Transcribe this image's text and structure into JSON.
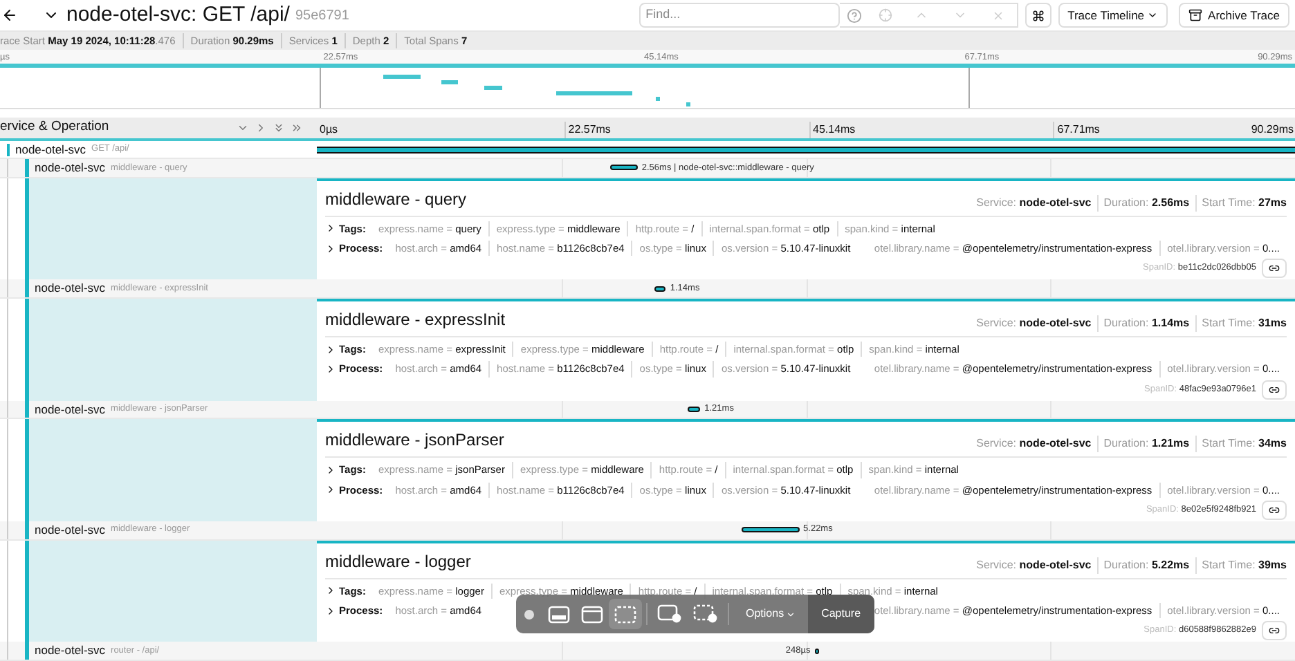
{
  "header": {
    "title": "node-otel-svc: GET /api/",
    "trace_id": "95e6791",
    "search": {
      "placeholder": "Find..."
    },
    "view_select": "Trace Timeline",
    "archive": "Archive Trace"
  },
  "summary": [
    {
      "label": "race Start",
      "value": "May 19 2024, 10:11:28",
      "suffix": ".476"
    },
    {
      "label": "Duration",
      "value": "90.29ms"
    },
    {
      "label": "Services",
      "value": "1"
    },
    {
      "label": "Depth",
      "value": "2"
    },
    {
      "label": "Total Spans",
      "value": "7"
    }
  ],
  "minimap": {
    "ticks": [
      "µs",
      "22.57ms",
      "45.14ms",
      "67.71ms",
      "90.29ms"
    ]
  },
  "columns": {
    "title": "ervice & Operation",
    "ticks": [
      "0µs",
      "22.57ms",
      "45.14ms",
      "67.71ms",
      "90.29ms"
    ]
  },
  "root": {
    "service": "node-otel-svc",
    "operation": "GET /api/",
    "children": [
      {
        "service": "node-otel-svc",
        "operation": "middleware - query",
        "bar_label": "2.56ms | node-otel-svc::middleware - query",
        "expanded": true,
        "detail": {
          "title": "middleware - query",
          "service_label": "Service:",
          "service": "node-otel-svc",
          "duration_label": "Duration:",
          "duration": "2.56ms",
          "start_label": "Start Time:",
          "start_time": "27ms",
          "tags_label": "Tags:",
          "tags": [
            {
              "key": "express.name =",
              "value": "query"
            },
            {
              "key": "express.type =",
              "value": "middleware"
            },
            {
              "key": "http.route =",
              "value": "/"
            },
            {
              "key": "internal.span.format =",
              "value": "otlp"
            },
            {
              "key": "span.kind =",
              "value": "internal"
            }
          ],
          "process_label": "Process:",
          "process": [
            {
              "key": "host.arch =",
              "value": "amd64"
            },
            {
              "key": "host.name =",
              "value": "b1126c8cb7e4"
            },
            {
              "key": "os.type =",
              "value": "linux"
            },
            {
              "key": "os.version =",
              "value": "5.10.47-linuxkit"
            },
            {
              "key": "otel.library.name =",
              "value": "@opentelemetry/instrumentation-express"
            },
            {
              "key": "otel.library.version =",
              "value": "0...."
            }
          ],
          "span_id_label": "SpanID:",
          "span_id": "be11c2dc026dbb05"
        }
      },
      {
        "service": "node-otel-svc",
        "operation": "middleware - expressInit",
        "bar_label": "1.14ms",
        "expanded": true,
        "detail": {
          "title": "middleware - expressInit",
          "service_label": "Service:",
          "service": "node-otel-svc",
          "duration_label": "Duration:",
          "duration": "1.14ms",
          "start_label": "Start Time:",
          "start_time": "31ms",
          "tags_label": "Tags:",
          "tags": [
            {
              "key": "express.name =",
              "value": "expressInit"
            },
            {
              "key": "express.type =",
              "value": "middleware"
            },
            {
              "key": "http.route =",
              "value": "/"
            },
            {
              "key": "internal.span.format =",
              "value": "otlp"
            },
            {
              "key": "span.kind =",
              "value": "internal"
            }
          ],
          "process_label": "Process:",
          "process": [
            {
              "key": "host.arch =",
              "value": "amd64"
            },
            {
              "key": "host.name =",
              "value": "b1126c8cb7e4"
            },
            {
              "key": "os.type =",
              "value": "linux"
            },
            {
              "key": "os.version =",
              "value": "5.10.47-linuxkit"
            },
            {
              "key": "otel.library.name =",
              "value": "@opentelemetry/instrumentation-express"
            },
            {
              "key": "otel.library.version =",
              "value": "0...."
            }
          ],
          "span_id_label": "SpanID:",
          "span_id": "48fac9e93a0796e1"
        }
      },
      {
        "service": "node-otel-svc",
        "operation": "middleware - jsonParser",
        "bar_label": "1.21ms",
        "expanded": true,
        "detail": {
          "title": "middleware - jsonParser",
          "service_label": "Service:",
          "service": "node-otel-svc",
          "duration_label": "Duration:",
          "duration": "1.21ms",
          "start_label": "Start Time:",
          "start_time": "34ms",
          "tags_label": "Tags:",
          "tags": [
            {
              "key": "express.name =",
              "value": "jsonParser"
            },
            {
              "key": "express.type =",
              "value": "middleware"
            },
            {
              "key": "http.route =",
              "value": "/"
            },
            {
              "key": "internal.span.format =",
              "value": "otlp"
            },
            {
              "key": "span.kind =",
              "value": "internal"
            }
          ],
          "process_label": "Process:",
          "process": [
            {
              "key": "host.arch =",
              "value": "amd64"
            },
            {
              "key": "host.name =",
              "value": "b1126c8cb7e4"
            },
            {
              "key": "os.type =",
              "value": "linux"
            },
            {
              "key": "os.version =",
              "value": "5.10.47-linuxkit"
            },
            {
              "key": "otel.library.name =",
              "value": "@opentelemetry/instrumentation-express"
            },
            {
              "key": "otel.library.version =",
              "value": "0...."
            }
          ],
          "span_id_label": "SpanID:",
          "span_id": "8e02e5f9248fb921"
        }
      },
      {
        "service": "node-otel-svc",
        "operation": "middleware - logger",
        "bar_label": "5.22ms",
        "expanded": true,
        "detail": {
          "title": "middleware - logger",
          "service_label": "Service:",
          "service": "node-otel-svc",
          "duration_label": "Duration:",
          "duration": "5.22ms",
          "start_label": "Start Time:",
          "start_time": "39ms",
          "tags_label": "Tags:",
          "tags": [
            {
              "key": "express.name =",
              "value": "logger"
            },
            {
              "key": "express.type =",
              "value": "middleware"
            },
            {
              "key": "http.route =",
              "value": "/"
            },
            {
              "key": "internal.span.format =",
              "value": "otlp"
            },
            {
              "key": "span.kind =",
              "value": "internal"
            }
          ],
          "process_label": "Process:",
          "process": [
            {
              "key": "host.arch =",
              "value": "amd64"
            },
            {
              "key": "otel.library.name =",
              "value": "@opentelemetry/instrumentation-express"
            },
            {
              "key": "otel.library.version =",
              "value": "0...."
            }
          ],
          "span_id_label": "SpanID:",
          "span_id": "d60588f9862882e9"
        }
      },
      {
        "service": "node-otel-svc",
        "operation": "router - /api/",
        "bar_label": "248µs",
        "expanded": false
      }
    ]
  },
  "capture_toolbar": {
    "modes": [
      {
        "kind": "screen",
        "selected": false
      },
      {
        "kind": "window",
        "selected": false
      },
      {
        "kind": "selection",
        "selected": true
      },
      {
        "kind": "record-screen",
        "selected": false
      },
      {
        "kind": "record-selection",
        "selected": false
      }
    ],
    "options": "Options",
    "capture": "Capture"
  }
}
